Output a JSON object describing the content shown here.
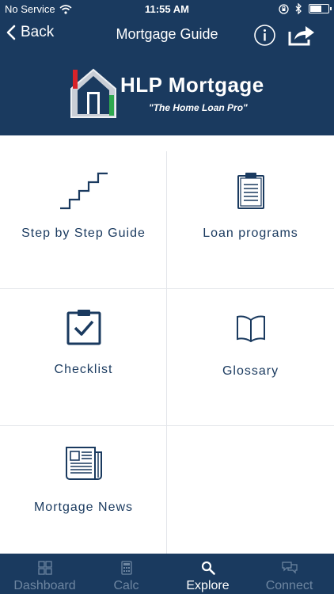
{
  "status_bar": {
    "carrier": "No Service",
    "time": "11:55 AM"
  },
  "nav": {
    "back_label": "Back",
    "title": "Mortgage Guide"
  },
  "brand": {
    "name": "HLP Mortgage",
    "tagline": "\"The Home Loan Pro\""
  },
  "menu": {
    "items": [
      {
        "label": "Step by Step Guide",
        "icon": "stairs-icon"
      },
      {
        "label": "Loan programs",
        "icon": "clipboard-list-icon"
      },
      {
        "label": "Checklist",
        "icon": "clipboard-check-icon"
      },
      {
        "label": "Glossary",
        "icon": "open-book-icon"
      },
      {
        "label": "Mortgage News",
        "icon": "newspaper-icon"
      }
    ]
  },
  "tabs": [
    {
      "label": "Dashboard",
      "icon": "dashboard-grid-icon",
      "active": false
    },
    {
      "label": "Calc",
      "icon": "calculator-icon",
      "active": false
    },
    {
      "label": "Explore",
      "icon": "search-icon",
      "active": true
    },
    {
      "label": "Connect",
      "icon": "chat-bubbles-icon",
      "active": false
    }
  ],
  "colors": {
    "primary": "#1a3a5f",
    "tab_inactive": "#6e86a1",
    "divider": "#e3e6ea",
    "background": "#ffffff"
  }
}
